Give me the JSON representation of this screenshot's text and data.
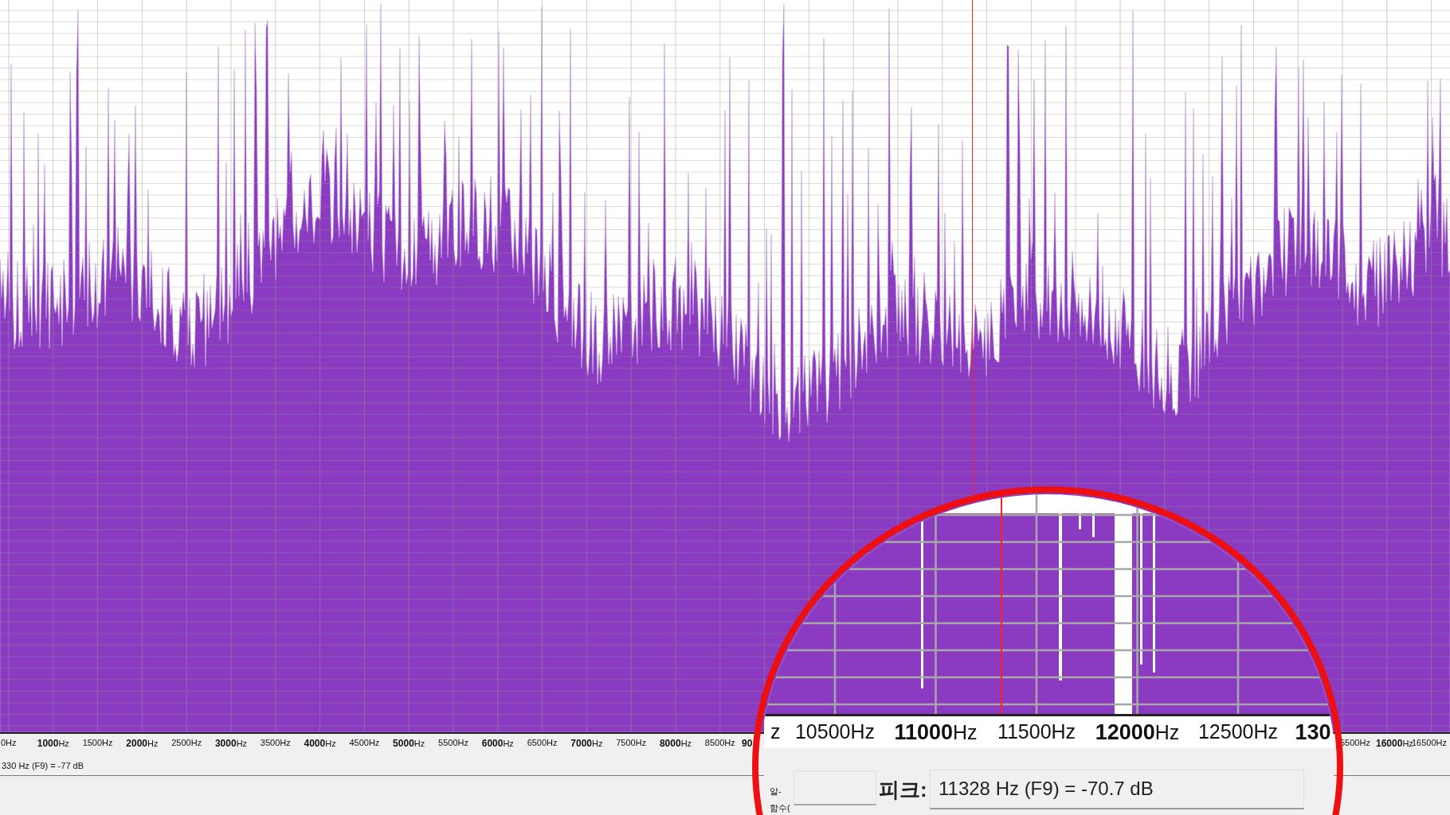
{
  "axis": {
    "ticks_left": [
      "0Hz",
      "**1000**Hz",
      "1500Hz",
      "**2000**Hz",
      "2500Hz",
      "**3000**Hz",
      "3500Hz",
      "**4000**Hz",
      "4500Hz",
      "**5000**Hz",
      "5500Hz",
      "**6000**Hz",
      "6500Hz",
      "**7000**Hz",
      "7500Hz",
      "**8000**Hz",
      "8500Hz",
      "**90**"
    ],
    "ticks_right": [
      "5500Hz",
      "**16000**Hz",
      "16500Hz"
    ]
  },
  "status": {
    "text": "330 Hz (F9) = -77 dB"
  },
  "magnifier": {
    "ticks": [
      "z",
      "10500Hz",
      "**11000**Hz",
      "11500Hz",
      "**12000**Hz",
      "12500Hz",
      "**130**"
    ],
    "side_labels": [
      "알-",
      "함수("
    ],
    "peak_label": "피크:",
    "peak_value": "11328 Hz (F9) = -70.7 dB"
  }
}
